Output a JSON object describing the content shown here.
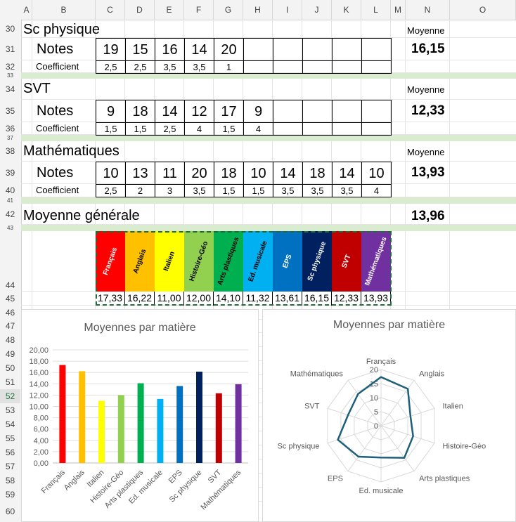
{
  "columns": [
    "A",
    "B",
    "C",
    "D",
    "E",
    "F",
    "G",
    "H",
    "I",
    "J",
    "K",
    "L",
    "M",
    "N",
    "O"
  ],
  "rows": [
    "30",
    "31",
    "32",
    "33",
    "34",
    "35",
    "36",
    "37",
    "38",
    "39",
    "40",
    "41",
    "42",
    "43",
    "44",
    "45",
    "46",
    "47",
    "48",
    "49",
    "50",
    "51",
    "52",
    "53",
    "54",
    "55",
    "56",
    "57",
    "58",
    "59",
    "60"
  ],
  "selected_row": "52",
  "sections": [
    {
      "title": "Sc physique",
      "notes_label": "Notes",
      "coef_label": "Coefficient",
      "notes": [
        "19",
        "15",
        "16",
        "14",
        "20",
        "",
        "",
        "",
        "",
        ""
      ],
      "coefs": [
        "2,5",
        "2,5",
        "3,5",
        "3,5",
        "1",
        "",
        "",
        "",
        "",
        ""
      ],
      "moyenne_label": "Moyenne",
      "moyenne": "16,15"
    },
    {
      "title": "SVT",
      "notes_label": "Notes",
      "coef_label": "Coefficient",
      "notes": [
        "9",
        "18",
        "14",
        "12",
        "17",
        "9",
        "",
        "",
        "",
        ""
      ],
      "coefs": [
        "1,5",
        "1,5",
        "2,5",
        "4",
        "1,5",
        "4",
        "",
        "",
        "",
        ""
      ],
      "moyenne_label": "Moyenne",
      "moyenne": "12,33"
    },
    {
      "title": "Mathématiques",
      "notes_label": "Notes",
      "coef_label": "Coefficient",
      "notes": [
        "10",
        "13",
        "11",
        "20",
        "18",
        "10",
        "14",
        "18",
        "14",
        "10"
      ],
      "coefs": [
        "2,5",
        "2",
        "3",
        "3,5",
        "1,5",
        "1,5",
        "3,5",
        "3,5",
        "3,5",
        "4"
      ],
      "moyenne_label": "Moyenne",
      "moyenne": "13,93"
    }
  ],
  "general": {
    "label": "Moyenne générale",
    "value": "13,96"
  },
  "summary": {
    "subjects": [
      {
        "name": "Français",
        "value": "17,33",
        "color": "#ff0000",
        "text": "#ffffff"
      },
      {
        "name": "Anglais",
        "value": "16,22",
        "color": "#ffc000",
        "text": "#000000"
      },
      {
        "name": "Italien",
        "value": "11,00",
        "color": "#ffff00",
        "text": "#000000"
      },
      {
        "name": "Histoire-Géo",
        "value": "12,00",
        "color": "#92d050",
        "text": "#000000"
      },
      {
        "name": "Arts plastiques",
        "value": "14,10",
        "color": "#00b050",
        "text": "#000000"
      },
      {
        "name": "Ed. musicale",
        "value": "11,32",
        "color": "#00b0f0",
        "text": "#000000"
      },
      {
        "name": "EPS",
        "value": "13,61",
        "color": "#0070c0",
        "text": "#ffffff"
      },
      {
        "name": "Sc physique",
        "value": "16,15",
        "color": "#002060",
        "text": "#ffffff"
      },
      {
        "name": "SVT",
        "value": "12,33",
        "color": "#c00000",
        "text": "#ffffff"
      },
      {
        "name": "Mathématiques",
        "value": "13,93",
        "color": "#7030a0",
        "text": "#ffffff"
      }
    ]
  },
  "chart_data": [
    {
      "type": "bar",
      "title": "Moyennes par matière",
      "categories": [
        "Français",
        "Anglais",
        "Italien",
        "Histoire-Géo",
        "Arts plastiques",
        "Ed. musicale",
        "EPS",
        "Sc physique",
        "SVT",
        "Mathématiques"
      ],
      "values": [
        17.33,
        16.22,
        11.0,
        12.0,
        14.1,
        11.32,
        13.61,
        16.15,
        12.33,
        13.93
      ],
      "colors": [
        "#ff0000",
        "#ffc000",
        "#ffff00",
        "#92d050",
        "#00b050",
        "#00b0f0",
        "#0070c0",
        "#002060",
        "#c00000",
        "#7030a0"
      ],
      "ylim": [
        0,
        20
      ],
      "yticks": [
        "0,00",
        "2,00",
        "4,00",
        "6,00",
        "8,00",
        "10,00",
        "12,00",
        "14,00",
        "16,00",
        "18,00",
        "20,00"
      ],
      "grid": true
    },
    {
      "type": "radar",
      "title": "Moyennes par matière",
      "categories": [
        "Français",
        "Anglais",
        "Italien",
        "Histoire-Géo",
        "Arts plastiques",
        "Ed. musicale",
        "EPS",
        "Sc physique",
        "SVT",
        "Mathématiques"
      ],
      "values": [
        17.33,
        16.22,
        11.0,
        12.0,
        14.1,
        11.32,
        13.61,
        16.15,
        12.33,
        13.93
      ],
      "rlim": [
        0,
        20
      ],
      "rticks": [
        "0",
        "5",
        "10",
        "15",
        "20"
      ],
      "line_color": "#1f5f7a"
    }
  ]
}
